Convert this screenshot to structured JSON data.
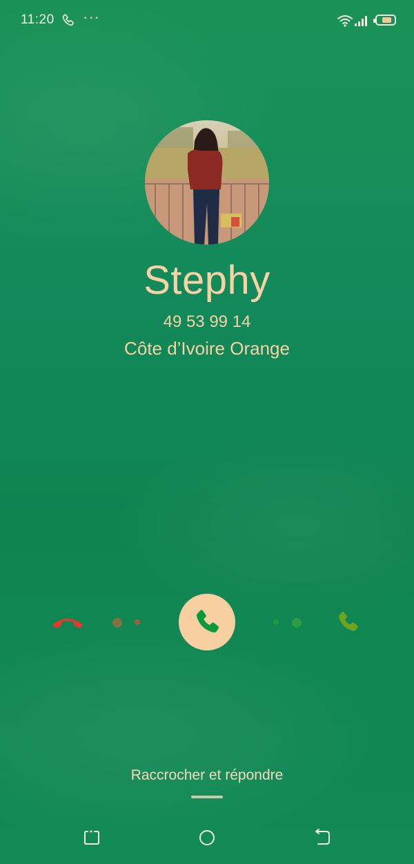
{
  "status_bar": {
    "time": "11:20",
    "more": "···",
    "battery_level": 0.6
  },
  "caller": {
    "name": "Stephy",
    "number": "49 53 99 14",
    "location": "Côte d’Ivoire  Orange"
  },
  "actions": {
    "decline_icon": "hang-up-icon",
    "answer_icon": "phone-icon",
    "accept_icon": "phone-icon"
  },
  "hint": "Raccrocher et répondre",
  "colors": {
    "background": "#12895a",
    "text": "#f8d2a4",
    "answer_button": "#f8cfa0",
    "answer_phone": "#0a9a3c",
    "decline": "#e6392b"
  },
  "nav_bar": {
    "left_icon": "recent-apps-icon",
    "center_icon": "home-icon",
    "right_icon": "back-icon"
  }
}
